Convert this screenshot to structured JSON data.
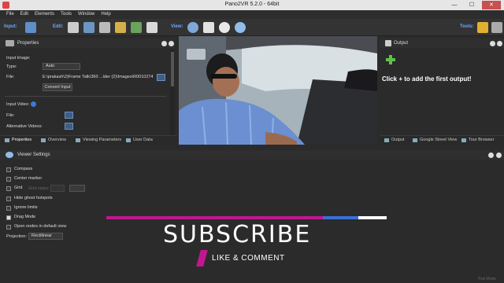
{
  "window": {
    "title": "Pano2VR 5.2.0 - 64bit",
    "min": "—",
    "max": "☐",
    "close": "✕"
  },
  "menu": [
    "File",
    "Edit",
    "Elements",
    "Tools",
    "Window",
    "Help"
  ],
  "toolbar": {
    "input_label": "Input:",
    "edit_label": "Edit:",
    "view_label": "View:",
    "tools_label": "Tools:"
  },
  "properties": {
    "title": "Properties",
    "input_image_heading": "Input Image:",
    "type_label": "Type:",
    "type_value": "Auto",
    "file_label": "File:",
    "file_value": "E:\\prakash\\2)Frame Talk\\360 ...lder (2)\\Images\\R0010274.JPG",
    "convert_button": "Convert Input",
    "input_video_heading": "Input Video:",
    "video_file_label": "File:",
    "alt_videos_label": "Alternative Videos:",
    "tabs": [
      "Properties",
      "Overview",
      "Viewing Parameters",
      "User Data"
    ]
  },
  "output": {
    "title": "Output",
    "hint": "Click + to add the first output!",
    "tabs": [
      "Output",
      "Google Street View",
      "Tour Browser"
    ]
  },
  "viewer_settings": {
    "title": "Viewer Settings",
    "options": [
      {
        "label": "Compass",
        "checked": false
      },
      {
        "label": "Center marker",
        "checked": false
      },
      {
        "label": "Grid",
        "checked": false
      },
      {
        "label": "Hide ghost hotspots",
        "checked": false
      },
      {
        "label": "Ignore limits",
        "checked": false
      },
      {
        "label": "Drag Mode",
        "checked": true
      },
      {
        "label": "Open nodes in default view",
        "checked": false
      }
    ],
    "grid_steps_label": "Grid steps:",
    "projection_label": "Projection:",
    "projection_value": "Rectilinear"
  },
  "overlay": {
    "subscribe": "SUBSCRIBE",
    "like_comment": "LIKE & COMMENT",
    "trial": "Trial Mode"
  },
  "colors": {
    "accent": "#69a9ff",
    "subscribe_bar": "#c0178f",
    "subscribe_blue": "#3a6fd8"
  }
}
